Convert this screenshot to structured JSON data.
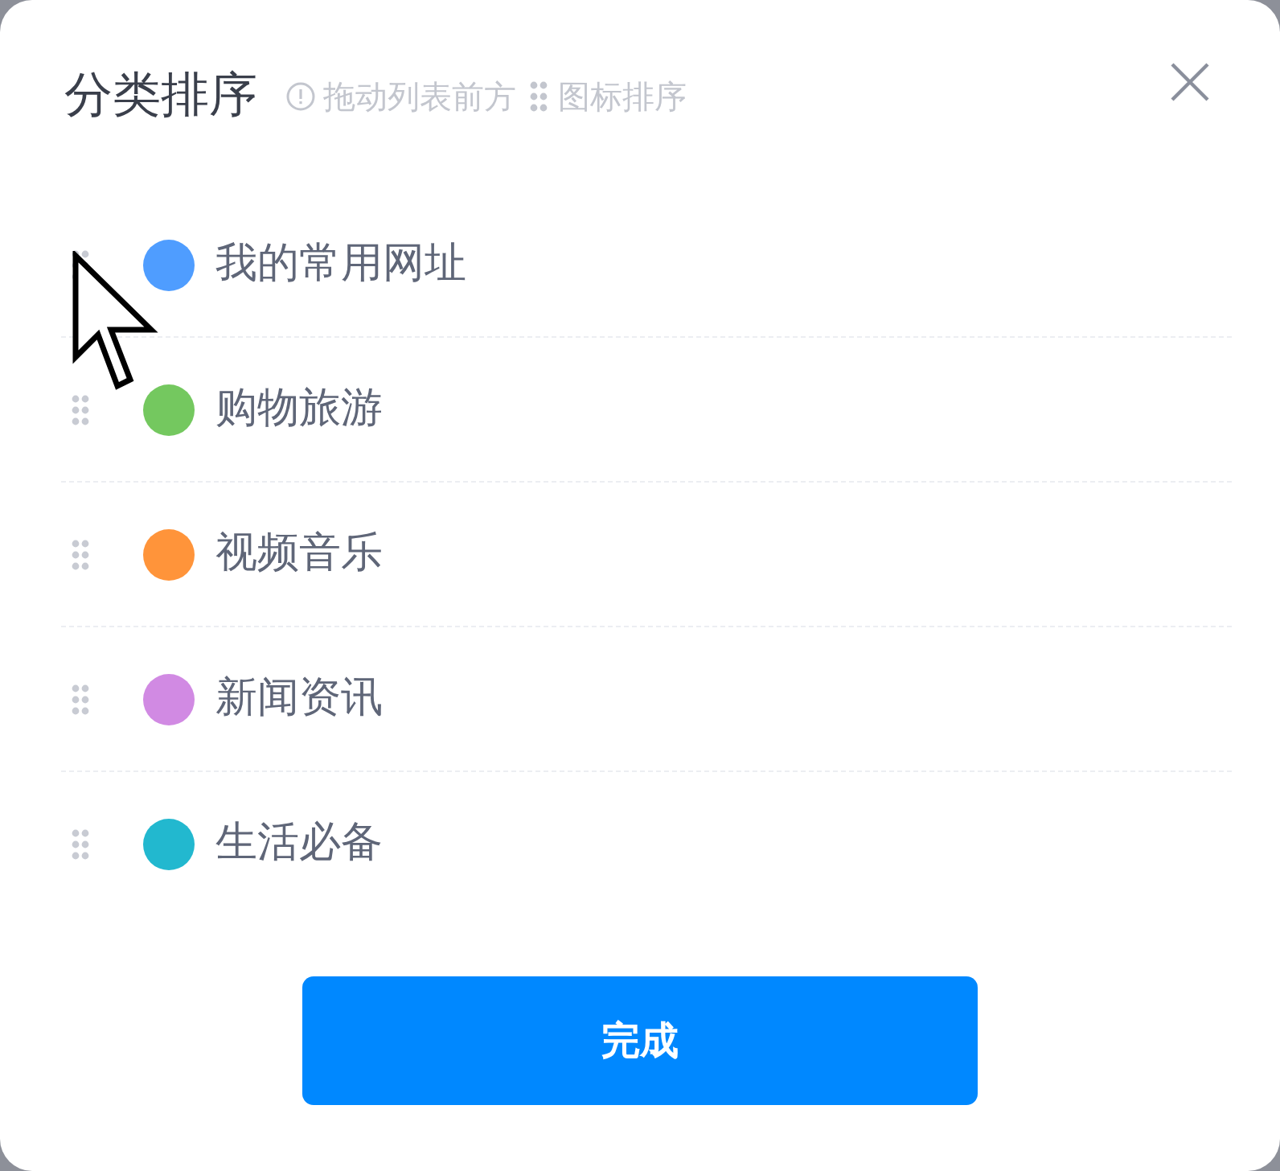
{
  "dialog": {
    "title": "分类排序",
    "hint_before": "拖动列表前方",
    "hint_after": "图标排序"
  },
  "categories": [
    {
      "name": "我的常用网址",
      "color": "#4f9dff"
    },
    {
      "name": "购物旅游",
      "color": "#74c85f"
    },
    {
      "name": "视频音乐",
      "color": "#ff943a"
    },
    {
      "name": "新闻资讯",
      "color": "#d18ae3"
    },
    {
      "name": "生活必备",
      "color": "#22b8cf"
    }
  ],
  "button": "完成"
}
